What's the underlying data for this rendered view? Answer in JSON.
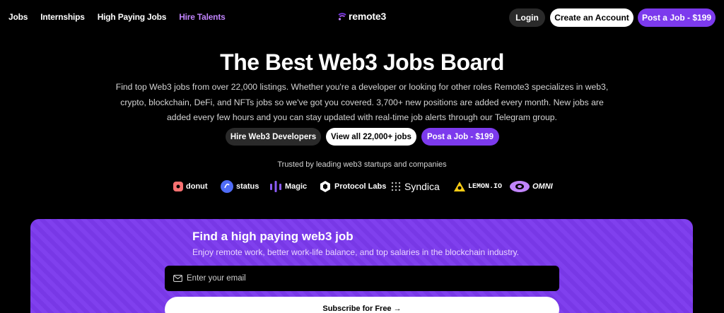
{
  "nav": {
    "links": [
      "Jobs",
      "Internships",
      "High Paying Jobs",
      "Hire Talents"
    ],
    "logo_text": "remote3",
    "login_label": "Login",
    "create_account_label": "Create an Account",
    "post_job_label": "Post a Job - $199"
  },
  "hero": {
    "title": "The Best Web3 Jobs Board",
    "description": "Find top Web3 jobs from over 22,000 listings. Whether you're a developer or looking for other roles Remote3 specializes in web3, crypto, blockchain, DeFi, and NFTs jobs so we've got you covered. 3,700+ new positions are added every month. New jobs are added every few hours and you can stay updated with real-time job alerts through our Telegram group.",
    "hire_label": "Hire Web3 Developers",
    "view_all_label": "View all 22,000+ jobs",
    "post_job_label": "Post a Job - $199"
  },
  "trusted": {
    "text": "Trusted by leading web3 startups and companies",
    "brands": [
      "donut",
      "status",
      "Magic",
      "Protocol Labs",
      "Syndica",
      "LEMON.IO",
      "OMNI"
    ]
  },
  "signup": {
    "title": "Find a high paying web3 job",
    "subtitle": "Enjoy remote work, better work-life balance, and top salaries in the blockchain industry.",
    "email_placeholder": "Enter your email",
    "subscribe_label": "Subscribe for Free →"
  },
  "colors": {
    "accent": "#7c3aed",
    "accent_light": "#c084fc",
    "background": "#000000"
  }
}
